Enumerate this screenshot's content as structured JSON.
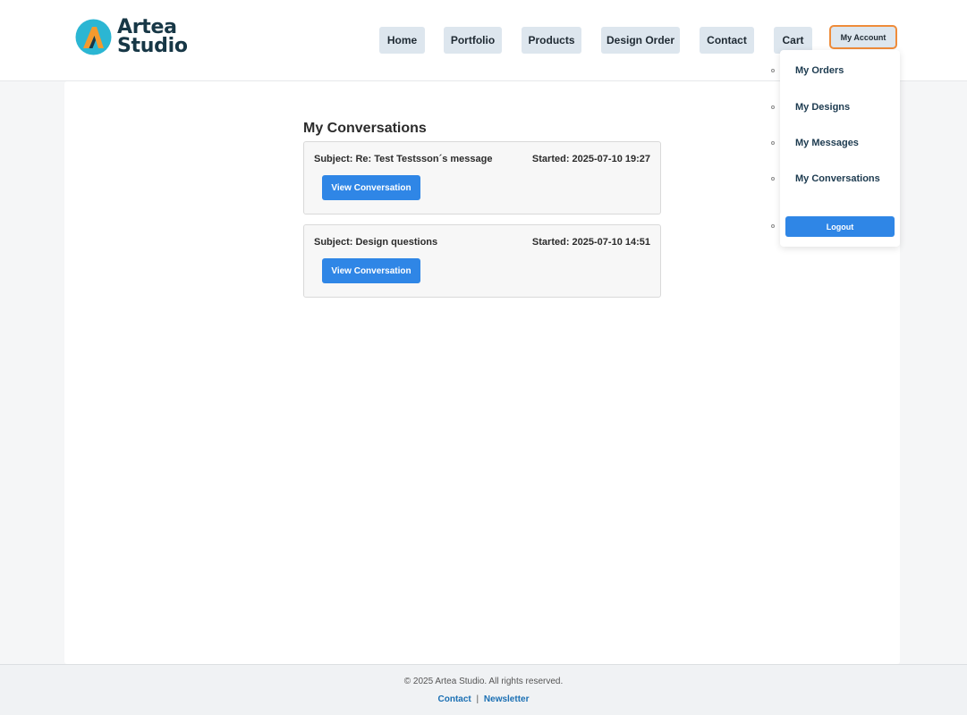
{
  "brand": {
    "line1": "Artea",
    "line2": "Studio",
    "colors": {
      "circle": "#2bb6d3",
      "mark": "#f39a2e",
      "text": "#173746"
    }
  },
  "nav": {
    "items": [
      {
        "label": "Home"
      },
      {
        "label": "Portfolio"
      },
      {
        "label": "Products"
      },
      {
        "label": "Design Order"
      },
      {
        "label": "Contact"
      },
      {
        "label": "Cart"
      }
    ],
    "account_label": "My Account"
  },
  "account_menu": {
    "items": [
      {
        "label": "My Orders"
      },
      {
        "label": "My Designs"
      },
      {
        "label": "My Messages"
      },
      {
        "label": "My Conversations"
      }
    ],
    "logout_label": "Logout"
  },
  "main": {
    "title": "My Conversations",
    "conversations": [
      {
        "subject": "Subject: Re: Test Testsson´s message",
        "started": "Started: 2025-07-10 19:27",
        "button_label": "View Conversation"
      },
      {
        "subject": "Subject: Design questions",
        "started": "Started: 2025-07-10 14:51",
        "button_label": "View Conversation"
      }
    ]
  },
  "footer": {
    "copyright": "© 2025 Artea Studio. All rights reserved.",
    "links": [
      {
        "label": "Contact"
      },
      {
        "label": "Newsletter"
      }
    ],
    "separator": "|"
  },
  "colors": {
    "accent": "#2f86e6",
    "nav_bg": "#dde6ee",
    "focus_outline": "#ef8c3a",
    "link": "#1a6fb3"
  },
  "icons": {
    "logo": "artea-logo-icon",
    "bullet": "hollow-circle-bullet"
  }
}
